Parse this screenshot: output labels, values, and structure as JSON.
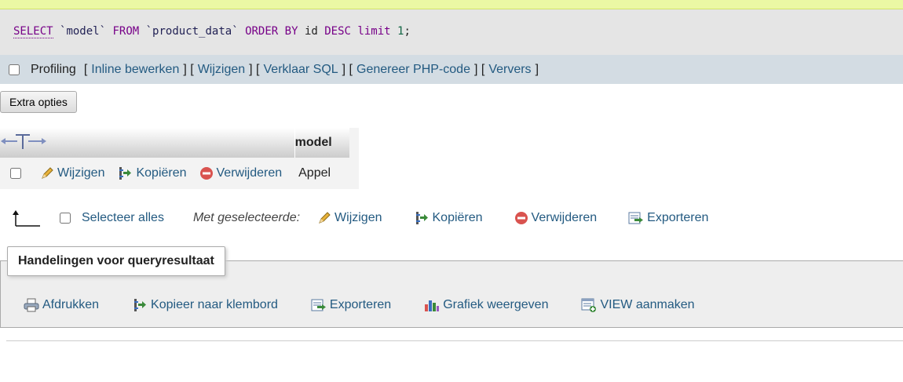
{
  "sql": {
    "select": "SELECT",
    "col": "`model`",
    "from": "FROM",
    "table": "`product_data`",
    "order_by": "ORDER BY",
    "id": "id",
    "desc": "DESC",
    "limit": "limit",
    "limit_val": "1",
    "end": ";"
  },
  "toolbar": {
    "profiling_label": "Profiling",
    "links": [
      "Inline bewerken",
      "Wijzigen",
      "Verklaar SQL",
      "Genereer PHP-code",
      "Ververs"
    ]
  },
  "extra_options_label": "Extra opties",
  "table": {
    "column_header": "model",
    "row": {
      "edit": "Wijzigen",
      "copy": "Kopiëren",
      "delete": "Verwijderen",
      "value": "Appel"
    }
  },
  "bulk": {
    "select_all": "Selecteer alles",
    "with_selected": "Met geselecteerde:",
    "edit": "Wijzigen",
    "copy": "Kopiëren",
    "delete": "Verwijderen",
    "export": "Exporteren"
  },
  "query_ops": {
    "legend": "Handelingen voor queryresultaat",
    "print": "Afdrukken",
    "copy_clipboard": "Kopieer naar klembord",
    "export": "Exporteren",
    "chart": "Grafiek weergeven",
    "create_view": "VIEW aanmaken"
  },
  "colors": {
    "link": "#235a81",
    "sql_bg": "#e5e5e5",
    "toolbar_bg": "#d3dce3",
    "success_bg": "#ebf8a4"
  }
}
